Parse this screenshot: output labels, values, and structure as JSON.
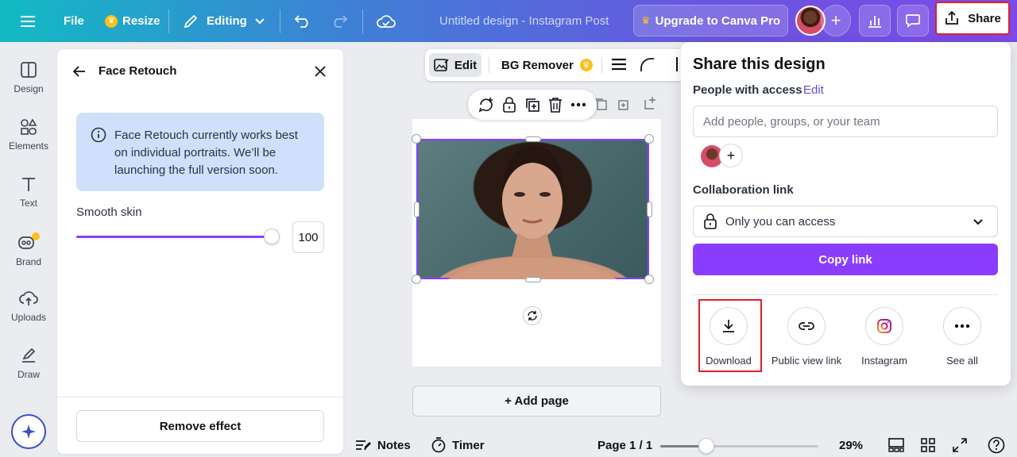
{
  "topbar": {
    "file_label": "File",
    "resize_label": "Resize",
    "editing_label": "Editing",
    "doc_title": "Untitled design - Instagram Post",
    "upgrade_label": "Upgrade to Canva Pro",
    "share_label": "Share"
  },
  "rail": {
    "items": [
      {
        "label": "Design",
        "icon": "layout-icon"
      },
      {
        "label": "Elements",
        "icon": "shapes-icon"
      },
      {
        "label": "Text",
        "icon": "text-icon"
      },
      {
        "label": "Brand",
        "icon": "brand-icon"
      },
      {
        "label": "Uploads",
        "icon": "cloud-upload-icon"
      },
      {
        "label": "Draw",
        "icon": "pen-icon"
      }
    ]
  },
  "panel": {
    "title": "Face Retouch",
    "info": "Face Retouch currently works best on individual portraits. We’ll be launching the full version soon.",
    "smooth_label": "Smooth skin",
    "smooth_value": "100",
    "remove_label": "Remove effect"
  },
  "canvas_toolbar": {
    "edit_label": "Edit",
    "bg_remover_label": "BG Remover"
  },
  "canvas": {
    "add_page_label": "+ Add page"
  },
  "bottom": {
    "notes_label": "Notes",
    "timer_label": "Timer",
    "page_label": "Page 1 / 1",
    "zoom_label": "29%"
  },
  "share": {
    "title": "Share this design",
    "people_label": "People with access",
    "edit_link": "Edit",
    "input_placeholder": "Add people, groups, or your team",
    "collab_label": "Collaboration link",
    "access_value": "Only you can access",
    "copy_label": "Copy link",
    "options": [
      {
        "label": "Download",
        "icon": "download-icon"
      },
      {
        "label": "Public view link",
        "icon": "link-icon"
      },
      {
        "label": "Instagram",
        "icon": "instagram-icon"
      },
      {
        "label": "See all",
        "icon": "more-icon"
      }
    ]
  },
  "colors": {
    "accent": "#8b3dff",
    "highlight": "#e0202a",
    "info_bg": "#cfe0fc"
  }
}
